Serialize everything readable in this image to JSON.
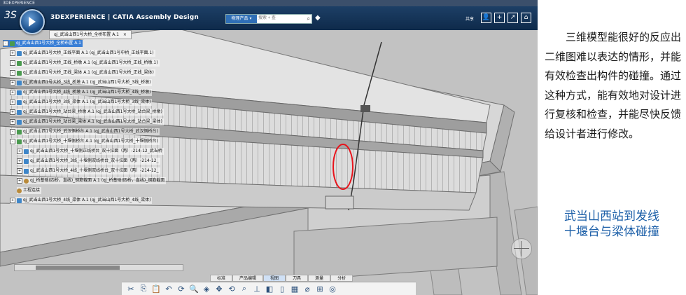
{
  "window": {
    "title": "3DEXPERIENCE"
  },
  "header": {
    "logo": "3S",
    "app_title": "3DEXPERIENCE | CATIA Assembly Design",
    "search_scope": "物理产品 ▾",
    "search_placeholder": "搜索 + 查",
    "share_label": "共享"
  },
  "document_tab": {
    "label": "qj_武当山西1号大桥_全桥布置 A.1",
    "close": "×"
  },
  "tree": {
    "items": [
      {
        "label": "qj_武当山西1号大桥_全桥布置 A.1",
        "indent": 0,
        "kind": "asm",
        "expand": "-",
        "selected": true
      },
      {
        "label": "qj_武当山西1号大桥_正线平面 A.1 (qj_武当山西1号中桥_正线平面.1)",
        "indent": 1,
        "kind": "part",
        "expand": "+"
      },
      {
        "label": "qj_武当山西1号大桥_正线_桥墩 A.1 (qj_武当山西1号大桥_正线_桥墩.1)",
        "indent": 1,
        "kind": "asm",
        "expand": "-"
      },
      {
        "label": "qj_武当山西1号大桥_正线_梁体 A.1 (qj_武当山西1号大桥_正线_梁体)",
        "indent": 1,
        "kind": "asm",
        "expand": "-"
      },
      {
        "label": "qj_武当山西1号大桥_3线_桥墩 A.1 (qj_武当山西1号大桥_3线_桥墩)",
        "indent": 1,
        "kind": "part",
        "expand": "+"
      },
      {
        "label": "qj_武当山西1号大桥_4线_桥墩 A.1 (qj_武当山西1号大桥_4线_桥墩)",
        "indent": 1,
        "kind": "part",
        "expand": "+"
      },
      {
        "label": "qj_武当山西1号大桥_3线_梁体 A.1 (qj_武当山西1号大桥_3线_梁体)",
        "indent": 1,
        "kind": "part",
        "expand": "+"
      },
      {
        "label": "qj_武当山西1号大桥_站台梁_桥墩 A.1 (qj_武当山西1号大桥_站台梁_桥墩)",
        "indent": 1,
        "kind": "part",
        "expand": "+"
      },
      {
        "label": "qj_武当山西1号大桥_站台梁_梁体 A.1 (qj_武当山西1号大桥_站台梁_梁体)",
        "indent": 1,
        "kind": "part",
        "expand": "+"
      },
      {
        "label": "qj_武当山西1号大桥_武汉侧桥台 A.1 (qj_武当山西1号大桥_武汉侧桥台)",
        "indent": 1,
        "kind": "asm",
        "expand": "-"
      },
      {
        "label": "qj_武当山西1号大桥_十堰侧桥台 A.1 (qj_武当山西1号大桥_十堰侧桥台)",
        "indent": 1,
        "kind": "asm",
        "expand": "-"
      },
      {
        "label": "qj_武当山西1号大桥_十堰侧正线桥台_双十拉面（两）-214-12_武当桥",
        "indent": 2,
        "kind": "part",
        "expand": "+"
      },
      {
        "label": "qj_武当山西1号大桥_3线_十堰侧双线桥台_双十拉面（两）-214-12_",
        "indent": 2,
        "kind": "part",
        "expand": "+"
      },
      {
        "label": "qj_武当山西1号大桥_4线_十堰侧双线桥台_双十拉面（两）-214-12_",
        "indent": 2,
        "kind": "part",
        "expand": "+"
      },
      {
        "label": "qj_桥基础(四桥，直线)_钢筋截面 A.1 (qj_桥基础(四桥，直线)_钢筋截面",
        "indent": 2,
        "kind": "oth",
        "expand": "+"
      },
      {
        "label": "工程连接",
        "indent": 2,
        "kind": "oth",
        "expand": ""
      },
      {
        "label": "qj_武当山西1号大桥_4线_梁体 A.1 (qj_武当山西1号大桥_4线_梁体)",
        "indent": 1,
        "kind": "part",
        "expand": "+"
      }
    ]
  },
  "bottom_tabs": [
    "标准",
    "产品编辑",
    "视图",
    "刀具",
    "测量",
    "分析"
  ],
  "bottom_active_tab": 2,
  "toolbar_icons": [
    "cut-icon",
    "copy-icon",
    "paste-icon",
    "undo-icon",
    "update-icon",
    "zoom-icon",
    "view-icon",
    "pan-icon",
    "rotate-icon",
    "search-3d-icon",
    "section-icon",
    "render-icon",
    "hide-icon",
    "layout-icon",
    "measure-icon",
    "tree-icon",
    "compass-icon"
  ],
  "toolbar_glyphs": [
    "✂",
    "⎘",
    "📋",
    "↶",
    "⟳",
    "🔍",
    "◈",
    "✥",
    "⟲",
    "⌕",
    "⊥",
    "◧",
    "▯",
    "▦",
    "⌀",
    "⊞",
    "◎"
  ],
  "annotation": {
    "shape": "ellipse",
    "color": "#e8141c"
  },
  "right_panel": {
    "paragraph": "三维模型能很好的反应出二维图难以表达的情形，并能有效检查出构件的碰撞。通过这种方式，能有效地对设计进行复核和检查，并能尽快反馈给设计者进行修改。",
    "caption_line1": "武当山西站到发线",
    "caption_line2": "十堰台与梁体碰撞",
    "caption_color": "#1c5fa8"
  }
}
